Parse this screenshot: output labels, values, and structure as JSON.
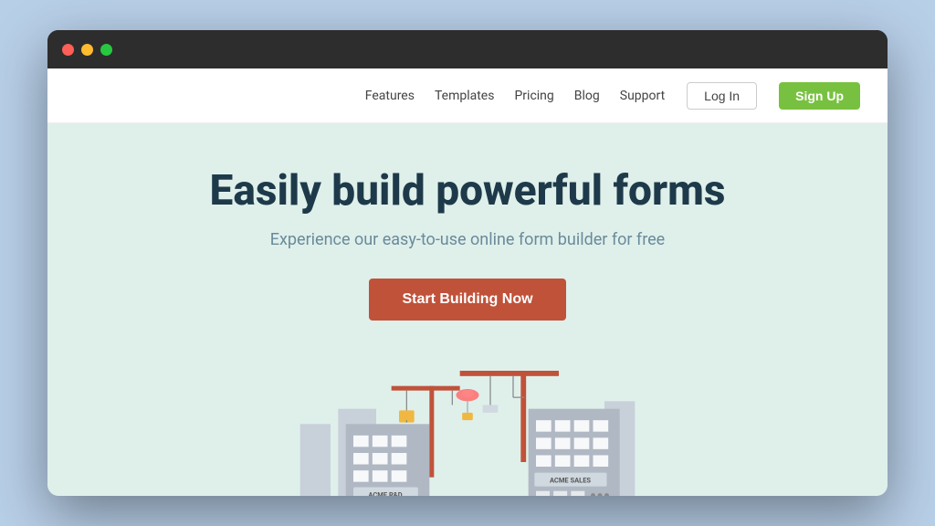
{
  "browser": {
    "dots": [
      "red",
      "yellow",
      "green"
    ]
  },
  "navbar": {
    "links": [
      "Features",
      "Templates",
      "Pricing",
      "Blog",
      "Support"
    ],
    "login_label": "Log In",
    "signup_label": "Sign Up"
  },
  "hero": {
    "title": "Easily build powerful forms",
    "subtitle": "Experience our easy-to-use online form builder for free",
    "cta_label": "Start Building Now"
  },
  "illustration": {
    "building1_label": "ACME R&D",
    "building2_label": "ACME SALES"
  }
}
